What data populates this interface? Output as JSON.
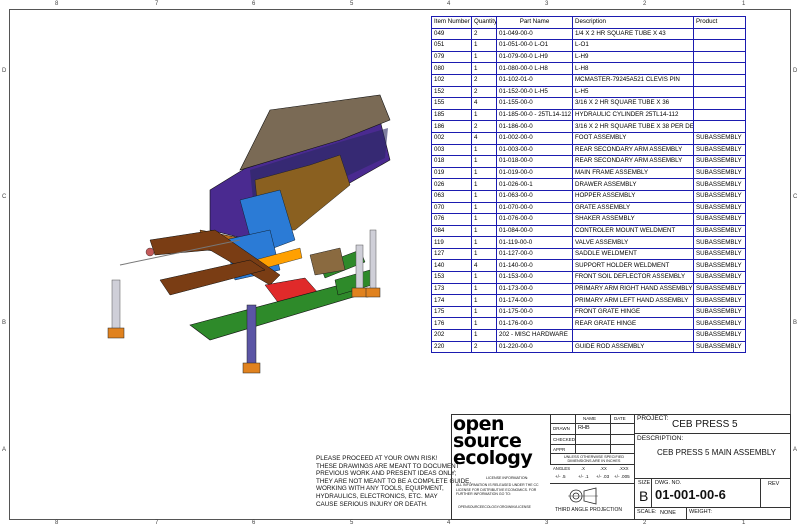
{
  "zones": {
    "top": [
      "8",
      "7",
      "6",
      "5",
      "4",
      "3",
      "2",
      "1"
    ],
    "bottom": [
      "8",
      "7",
      "6",
      "5",
      "4",
      "3",
      "2",
      "1"
    ],
    "left": [
      "D",
      "C",
      "B",
      "A"
    ],
    "right": [
      "D",
      "C",
      "B",
      "A"
    ]
  },
  "bom": {
    "headers": [
      "Item Number",
      "Quantity",
      "Part Name",
      "Description",
      "Product"
    ],
    "rows": [
      [
        "049",
        "2",
        "01-049-00-0",
        "1/4 X 2 HR SQUARE TUBE X 43",
        ""
      ],
      [
        "051",
        "1",
        "01-051-00-0 L-O1",
        "L-O1",
        ""
      ],
      [
        "079",
        "1",
        "01-079-00-0 L-H9",
        "L-H9",
        ""
      ],
      [
        "080",
        "1",
        "01-080-00-0 L-H8",
        "L-H8",
        ""
      ],
      [
        "102",
        "2",
        "01-102-01-0",
        "MCMASTER-79245A521 CLEVIS PIN",
        ""
      ],
      [
        "152",
        "2",
        "01-152-00-0 L-H5",
        "L-H5",
        ""
      ],
      [
        "155",
        "4",
        "01-155-00-0",
        "3/16 X 2 HR SQUARE TUBE X 36",
        ""
      ],
      [
        "185",
        "1",
        "01-185-00-0 - 25TL14-112",
        "HYDRAULIC CYLINDER 25TL14-112",
        ""
      ],
      [
        "186",
        "2",
        "01-186-00-0",
        "3/16 X 2 HR SQUARE TUBE X 38 PER DE",
        ""
      ],
      [
        "002",
        "4",
        "01-002-00-0",
        "FOOT ASSEMBLY",
        "SUBASSEMBLY"
      ],
      [
        "003",
        "1",
        "01-003-00-0",
        "REAR SECONDARY ARM ASSEMBLY",
        "SUBASSEMBLY"
      ],
      [
        "018",
        "1",
        "01-018-00-0",
        "REAR SECONDARY ARM ASSEMBLY",
        "SUBASSEMBLY"
      ],
      [
        "019",
        "1",
        "01-019-00-0",
        "MAIN FRAME ASSEMBLY",
        "SUBASSEMBLY"
      ],
      [
        "026",
        "1",
        "01-026-00-1",
        "DRAWER ASSEMBLY",
        "SUBASSEMBLY"
      ],
      [
        "063",
        "1",
        "01-063-00-0",
        "HOPPER ASSEMBLY",
        "SUBASSEMBLY"
      ],
      [
        "070",
        "1",
        "01-070-00-0",
        "GRATE ASSEMBLY",
        "SUBASSEMBLY"
      ],
      [
        "076",
        "1",
        "01-076-00-0",
        "SHAKER ASSEMBLY",
        "SUBASSEMBLY"
      ],
      [
        "084",
        "1",
        "01-084-00-0",
        "CONTROLER MOUNT WELDMENT",
        "SUBASSEMBLY"
      ],
      [
        "119",
        "1",
        "01-119-00-0",
        "VALVE ASSEMBLY",
        "SUBASSEMBLY"
      ],
      [
        "127",
        "1",
        "01-127-00-0",
        "SADDLE WELDMENT",
        "SUBASSEMBLY"
      ],
      [
        "140",
        "4",
        "01-140-00-0",
        "SUPPORT HOLDER WELDMENT",
        "SUBASSEMBLY"
      ],
      [
        "153",
        "1",
        "01-153-00-0",
        "FRONT SOIL DEFLECTOR ASSEMBLY",
        "SUBASSEMBLY"
      ],
      [
        "173",
        "1",
        "01-173-00-0",
        "PRIMARY ARM RIGHT HAND ASSEMBLY",
        "SUBASSEMBLY"
      ],
      [
        "174",
        "1",
        "01-174-00-0",
        "PRIMARY ARM LEFT HAND ASSEMBLY",
        "SUBASSEMBLY"
      ],
      [
        "175",
        "1",
        "01-175-00-0",
        "FRONT GRATE HINGE",
        "SUBASSEMBLY"
      ],
      [
        "176",
        "1",
        "01-176-00-0",
        "REAR GRATE HINGE",
        "SUBASSEMBLY"
      ],
      [
        "202",
        "1",
        "202 - MISC HARDWARE",
        "",
        "SUBASSEMBLY"
      ],
      [
        "220",
        "2",
        "01-220-00-0",
        "GUIDE ROD ASSEMBLY",
        "SUBASSEMBLY"
      ]
    ]
  },
  "disclaimer": [
    "PLEASE PROCEED AT YOUR OWN RISK!",
    "THESE DRAWINGS ARE MEANT TO DOCUMENT",
    "PREVIOUS WORK AND PRESENT IDEAS ONLY;",
    "THEY ARE NOT MEANT TO BE A COMPLETE GUIDE.",
    "WORKING WITH ANY TOOLS, EQUIPMENT,",
    "HYDRAULICS, ELECTRONICS, ETC. MAY",
    "CAUSE SERIOUS INJURY OR DEATH."
  ],
  "logo": [
    "open",
    "source",
    "ecology"
  ],
  "titleblock": {
    "name_hdr": "NAME",
    "date_hdr": "DATE",
    "drawn_label": "DRAWN",
    "drawn_name": "RHB",
    "checked_label": "CHECKED",
    "appr_label": "APPR",
    "units_note": "UNLESS OTHERWISE SPECIFIED DIMENSIONS ARE IN INCHES",
    "angles_label": "ANGLES",
    "angles_val": "+/- .5",
    "x_label": ".X",
    "x_val": "+/- .1",
    "xx_label": ".XX",
    "xx_val": "+/- .03",
    "xxx_label": ".XXX",
    "xxx_val": "+/- .005",
    "license_hdr": "LICENSE INFORMATION:",
    "license_text": "ALL INFORMATION IS RELEASED UNDER THE CC LICENSE FOR DISTRIBUTIVE ECONOMICS. FOR FURTHER INFORMATION GO TO:",
    "license_url": "OPENSOURCEECOLOGY.ORG/WIKI/LICENSE",
    "projection": "THIRD ANGLE PROJECTION",
    "project_label": "PROJECT:",
    "project": "CEB PRESS 5",
    "desc_label": "DESCRIPTION:",
    "description": "CEB PRESS 5 MAIN ASSEMBLY",
    "size_label": "SIZE",
    "size": "B",
    "dwg_label": "DWG. NO.",
    "dwg_no": "01-001-00-6",
    "rev_label": "REV",
    "scale_label": "SCALE:",
    "scale": "NONE",
    "weight_label": "WEIGHT:"
  },
  "colors": {
    "table_border": "#1b1bb0",
    "hopper": "#4a2a90",
    "frame_green": "#2e8a2a",
    "orange_feet": "#e0821f",
    "brown_arms": "#7a3d14",
    "blue_shaker": "#2b7bd6",
    "red_drawer": "#e02a2a"
  }
}
